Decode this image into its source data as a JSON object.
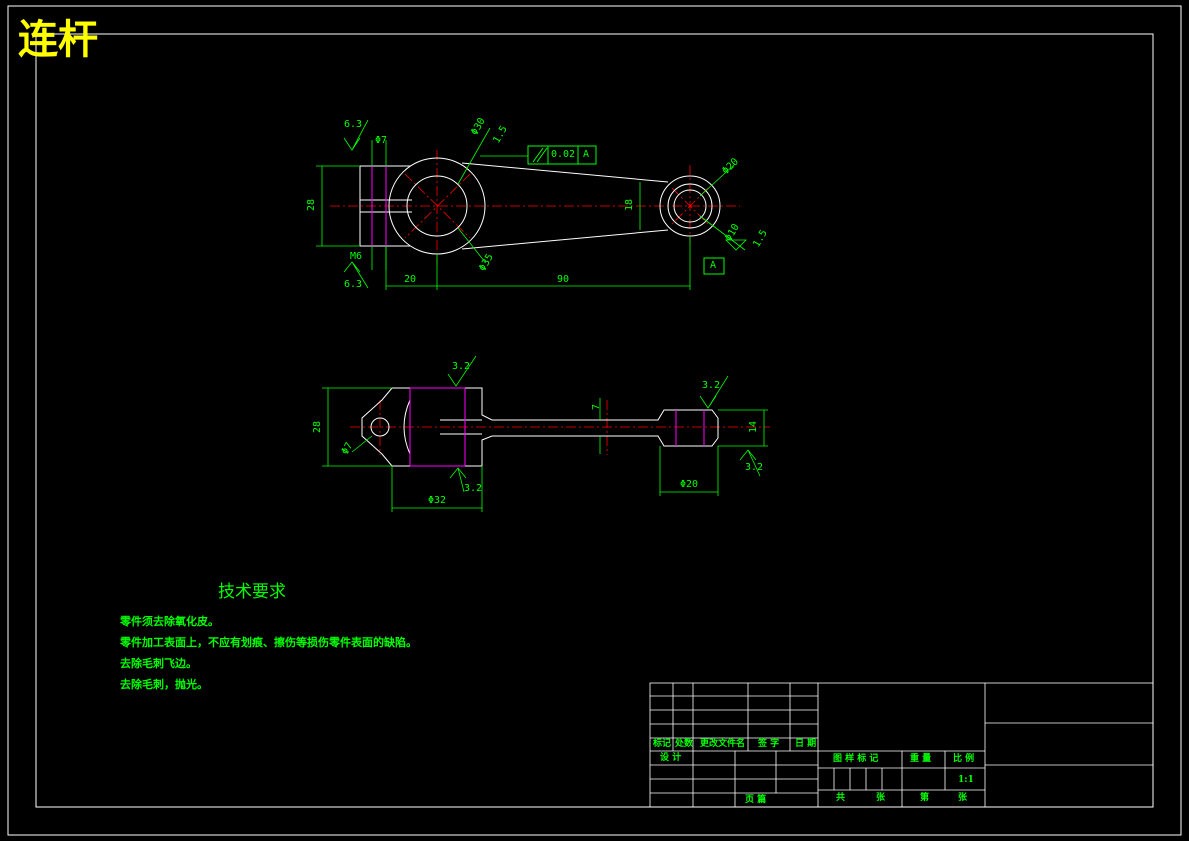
{
  "title": "连杆",
  "tech_requirements": {
    "heading": "技术要求",
    "items": [
      "零件须去除氧化皮。",
      "零件加工表面上，不应有划痕、擦伤等损伤零件表面的缺陷。",
      "去除毛刺飞边。",
      "去除毛刺，抛光。"
    ]
  },
  "front_view": {
    "roughness_top": "6.3",
    "roughness_bottom": "6.3",
    "dia_top_small": "Φ7",
    "dia_bore_big": "Φ30",
    "chamfer_big": "1.5",
    "tolerance_value": "0.02",
    "tolerance_datum": "A",
    "dia_small_end": "Φ20",
    "height_left": "28",
    "height_mid": "18",
    "thread": "M6",
    "dia_boss": "Φ35",
    "dia_small_bore": "Φ10",
    "chamfer_small": "1.5",
    "datum_label": "A",
    "len_left": "20",
    "len_main": "90"
  },
  "side_view": {
    "roughness_top_left": "3.2",
    "roughness_bottom_left": "3.2",
    "roughness_top_right": "3.2",
    "roughness_bottom_right": "3.2",
    "height_left": "28",
    "dia_pin": "Φ7",
    "web_thickness": "7",
    "height_right": "14",
    "dia_left": "Φ32",
    "dia_right": "Φ20"
  },
  "title_block": {
    "col_mark": "标记",
    "col_count": "处数",
    "col_doc": "更改文件名",
    "col_sign": "签 字",
    "col_date": "日 期",
    "design": "设 计",
    "sheet": "页 篇",
    "stage_mark": "图 样 标 记",
    "weight": "重 量",
    "scale": "比 例",
    "scale_value": "1:1",
    "total": "共",
    "sheets1": "张",
    "page": "第",
    "sheets2": "张"
  },
  "colors": {
    "frame": "#ffffff",
    "dimension": "#00ff00",
    "centerline": "#ff0000",
    "hidden": "#ff00ff",
    "title": "#ffff00"
  }
}
